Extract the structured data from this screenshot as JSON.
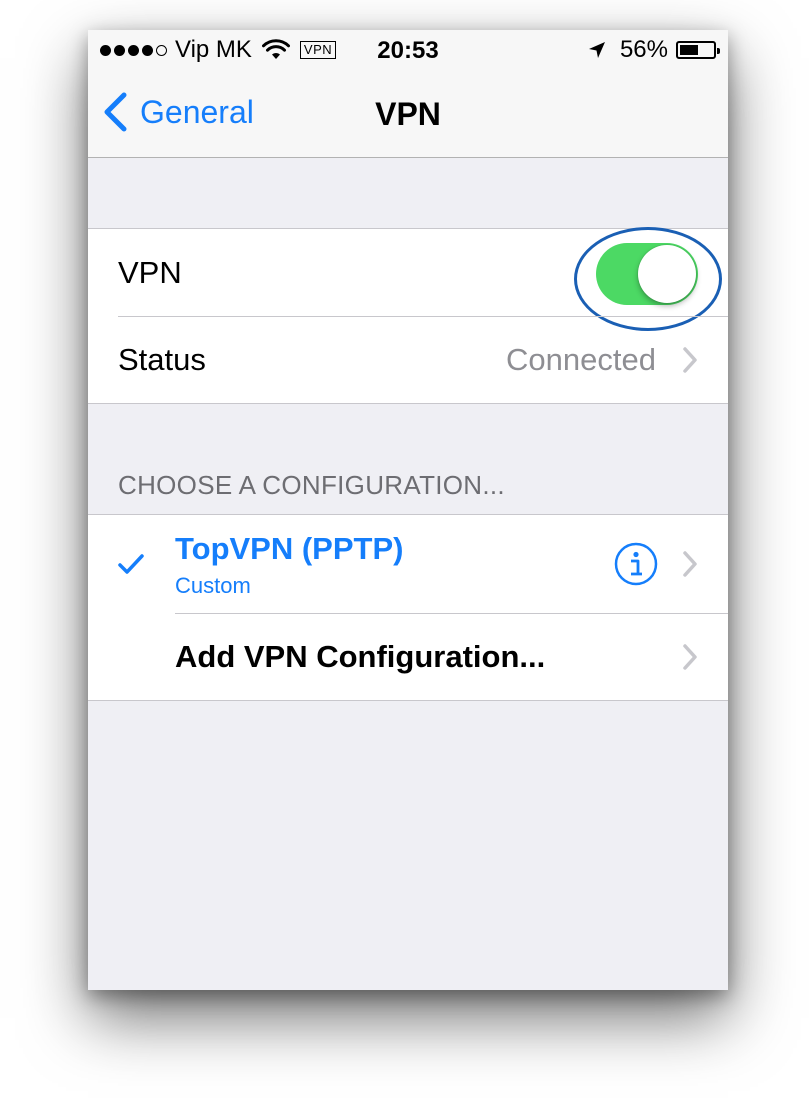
{
  "statusbar": {
    "carrier": "Vip MK",
    "vpn_badge": "VPN",
    "time": "20:53",
    "battery_pct": "56%",
    "battery_level": 0.56,
    "signal_bars": 4,
    "signal_total": 5
  },
  "navbar": {
    "back_label": "General",
    "title": "VPN"
  },
  "vpn_group": {
    "vpn_label": "VPN",
    "vpn_on": true,
    "status_label": "Status",
    "status_value": "Connected"
  },
  "config_section": {
    "header": "CHOOSE A CONFIGURATION...",
    "items": [
      {
        "name": "TopVPN (PPTP)",
        "subtitle": "Custom",
        "selected": true
      }
    ],
    "add_label": "Add VPN Configuration..."
  },
  "colors": {
    "accent": "#157efb",
    "toggle_on": "#4cd964",
    "highlight_ring": "#1a5fb4",
    "background": "#efeff4",
    "secondary_text": "#8e8e93"
  },
  "icons": {
    "back": "chevron-left-icon",
    "wifi": "wifi-icon",
    "location": "location-arrow-icon",
    "battery": "battery-icon",
    "check": "checkmark-icon",
    "info": "info-icon",
    "disclosure": "chevron-right-icon"
  }
}
